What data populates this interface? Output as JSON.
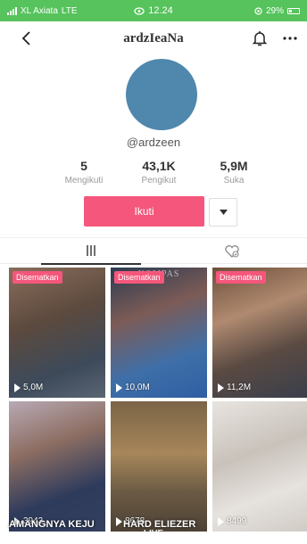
{
  "status_bar": {
    "carrier": "XL Axiata",
    "network": "LTE",
    "time": "12.24",
    "battery": "29%"
  },
  "header": {
    "title": "ardzIeaNa",
    "back_icon": "chevron-left-icon",
    "bell_icon": "bell-icon",
    "more_icon": "more-icon"
  },
  "profile": {
    "username": "@ardzeen",
    "avatar_color": "#4f87ad",
    "stats": [
      {
        "value": "5",
        "label": "Mengikuti"
      },
      {
        "value": "43,1K",
        "label": "Pengikut"
      },
      {
        "value": "5,9M",
        "label": "Suka"
      }
    ],
    "follow_label": "Ikuti",
    "accent": "#f4577b"
  },
  "tabs": {
    "videos_icon": "grid-icon",
    "liked_icon": "liked-heart-icon"
  },
  "videos": [
    {
      "pinned": true,
      "pin_label": "Disematkan",
      "views": "5,0M"
    },
    {
      "pinned": true,
      "pin_label": "Disematkan",
      "views": "10,0M",
      "logo": "KOMPAS"
    },
    {
      "pinned": true,
      "pin_label": "Disematkan",
      "views": "11,2M"
    },
    {
      "pinned": false,
      "views": "3943"
    },
    {
      "pinned": false,
      "views": "8678"
    },
    {
      "pinned": false,
      "views": "8499"
    }
  ],
  "overlay_text": "AMANGNYA KEJU",
  "overlay_text_2": "HARD ELIEZER",
  "bottom_watermark": "LIVE"
}
